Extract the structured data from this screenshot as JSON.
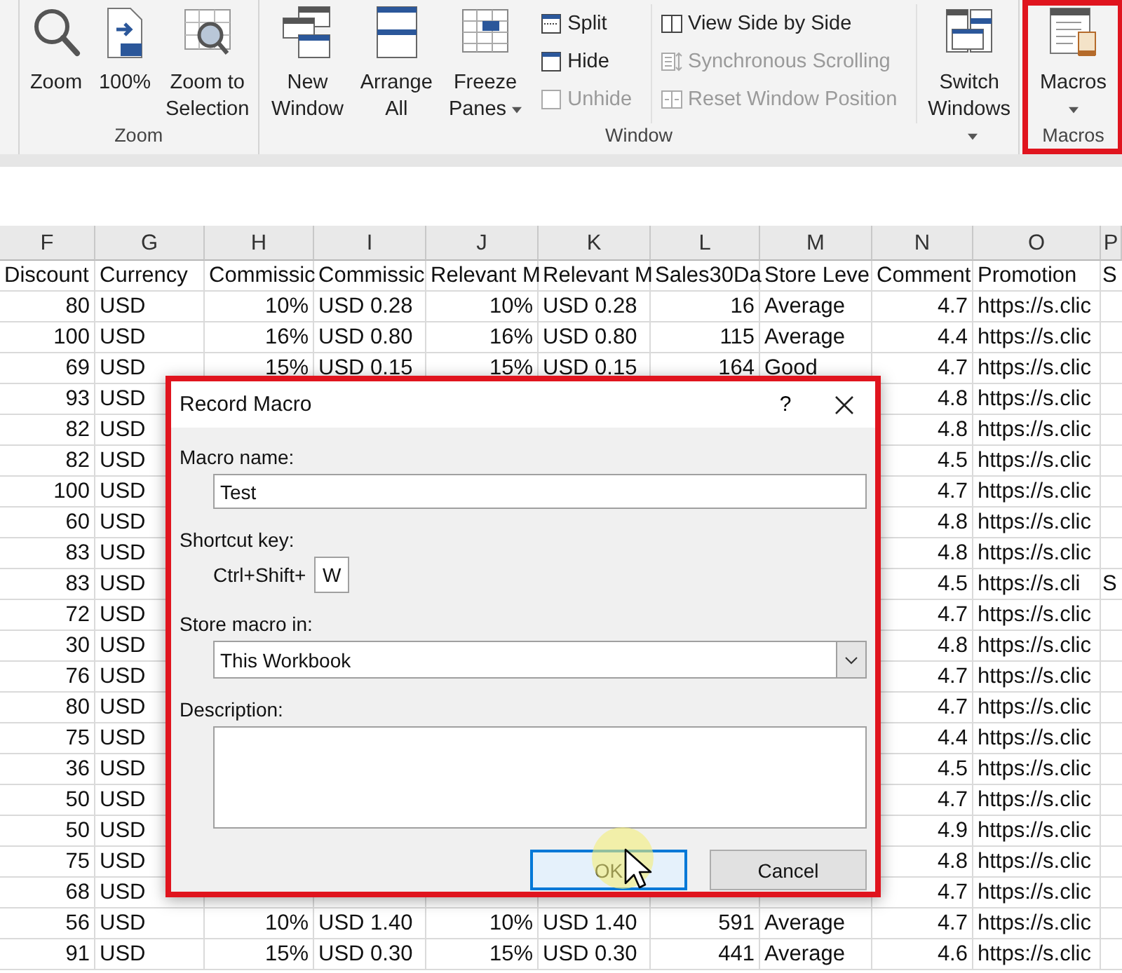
{
  "ribbon": {
    "groups": [
      {
        "label": "Zoom",
        "highlighted": false,
        "items": [
          {
            "kind": "large",
            "label": "Zoom",
            "dropdown": false
          },
          {
            "kind": "large",
            "label": "100%",
            "dropdown": false
          },
          {
            "kind": "large",
            "label": "Zoom to Selection",
            "dropdown": false
          }
        ]
      },
      {
        "label": "Window",
        "highlighted": false,
        "items": [
          {
            "kind": "large",
            "label": "New Window",
            "dropdown": false
          },
          {
            "kind": "large",
            "label": "Arrange All",
            "dropdown": false
          },
          {
            "kind": "large",
            "label": "Freeze Panes",
            "dropdown": true
          },
          {
            "kind": "stack",
            "items": [
              {
                "label": "Split",
                "disabled": false
              },
              {
                "label": "Hide",
                "disabled": false
              },
              {
                "label": "Unhide",
                "disabled": true
              }
            ]
          },
          {
            "kind": "stack",
            "items": [
              {
                "label": "View Side by Side",
                "disabled": false
              },
              {
                "label": "Synchronous Scrolling",
                "disabled": true
              },
              {
                "label": "Reset Window Position",
                "disabled": true
              }
            ]
          },
          {
            "kind": "large",
            "label": "Switch Windows",
            "dropdown": true
          }
        ]
      },
      {
        "label": "Macros",
        "highlighted": true,
        "items": [
          {
            "kind": "large",
            "label": "Macros",
            "dropdown": true
          }
        ]
      }
    ]
  },
  "sheet": {
    "columns": [
      {
        "letter": "F",
        "header": "Discount",
        "numeric": true
      },
      {
        "letter": "G",
        "header": "Currency",
        "numeric": false
      },
      {
        "letter": "H",
        "header": "Commissic",
        "numeric": true
      },
      {
        "letter": "I",
        "header": "Commissic",
        "numeric": false
      },
      {
        "letter": "J",
        "header": "Relevant M",
        "numeric": true
      },
      {
        "letter": "K",
        "header": "Relevant M",
        "numeric": false
      },
      {
        "letter": "L",
        "header": "Sales30Da",
        "numeric": true
      },
      {
        "letter": "M",
        "header": "Store Leve",
        "numeric": false
      },
      {
        "letter": "N",
        "header": "Comment",
        "numeric": true
      },
      {
        "letter": "O",
        "header": "Promotion",
        "numeric": false
      },
      {
        "letter": "P",
        "header": "S",
        "numeric": false
      }
    ],
    "rows": [
      {
        "F": "80",
        "G": "USD",
        "H": "10%",
        "I": "USD 0.28",
        "J": "10%",
        "K": "USD 0.28",
        "L": "16",
        "M": "Average",
        "N": "4.7",
        "O": "https://s.clic"
      },
      {
        "F": "100",
        "G": "USD",
        "H": "16%",
        "I": "USD 0.80",
        "J": "16%",
        "K": "USD 0.80",
        "L": "115",
        "M": "Average",
        "N": "4.4",
        "O": "https://s.clic"
      },
      {
        "F": "69",
        "G": "USD",
        "H": "15%",
        "I": "USD 0.15",
        "J": "15%",
        "K": "USD 0.15",
        "L": "164",
        "M": "Good",
        "N": "4.7",
        "O": "https://s.clic"
      },
      {
        "F": "93",
        "G": "USD",
        "N": "4.8",
        "O": "https://s.clic"
      },
      {
        "F": "82",
        "G": "USD",
        "N": "4.8",
        "O": "https://s.clic"
      },
      {
        "F": "82",
        "G": "USD",
        "N": "4.5",
        "O": "https://s.clic"
      },
      {
        "F": "100",
        "G": "USD",
        "N": "4.7",
        "O": "https://s.clic"
      },
      {
        "F": "60",
        "G": "USD",
        "N": "4.8",
        "O": "https://s.clic"
      },
      {
        "F": "83",
        "G": "USD",
        "N": "4.8",
        "O": "https://s.clic"
      },
      {
        "F": "83",
        "G": "USD",
        "N": "4.5",
        "O": "https://s.cli",
        "P": "S"
      },
      {
        "F": "72",
        "G": "USD",
        "N": "4.7",
        "O": "https://s.clic"
      },
      {
        "F": "30",
        "G": "USD",
        "N": "4.8",
        "O": "https://s.clic"
      },
      {
        "F": "76",
        "G": "USD",
        "N": "4.7",
        "O": "https://s.clic"
      },
      {
        "F": "80",
        "G": "USD",
        "N": "4.7",
        "O": "https://s.clic"
      },
      {
        "F": "75",
        "G": "USD",
        "N": "4.4",
        "O": "https://s.clic"
      },
      {
        "F": "36",
        "G": "USD",
        "N": "4.5",
        "O": "https://s.clic"
      },
      {
        "F": "50",
        "G": "USD",
        "N": "4.7",
        "O": "https://s.clic"
      },
      {
        "F": "50",
        "G": "USD",
        "N": "4.9",
        "O": "https://s.clic"
      },
      {
        "F": "75",
        "G": "USD",
        "N": "4.8",
        "O": "https://s.clic"
      },
      {
        "F": "68",
        "G": "USD",
        "N": "4.7",
        "O": "https://s.clic"
      },
      {
        "F": "56",
        "G": "USD",
        "H": "10%",
        "I": "USD 1.40",
        "J": "10%",
        "K": "USD 1.40",
        "L": "591",
        "M": "Average",
        "N": "4.7",
        "O": "https://s.clic"
      },
      {
        "F": "91",
        "G": "USD",
        "H": "15%",
        "I": "USD 0.30",
        "J": "15%",
        "K": "USD 0.30",
        "L": "441",
        "M": "Average",
        "N": "4.6",
        "O": "https://s.clic"
      }
    ]
  },
  "dialog": {
    "title": "Record Macro",
    "help": "?",
    "highlighted": true,
    "macro_name": {
      "label": "Macro name:",
      "value": "Test"
    },
    "shortcut": {
      "label": "Shortcut key:",
      "prefix": "Ctrl+Shift+",
      "value": "W"
    },
    "store_in": {
      "label": "Store macro in:",
      "value": "This Workbook"
    },
    "description": {
      "label": "Description:"
    },
    "buttons": [
      {
        "label": "OK",
        "default": true
      },
      {
        "label": "Cancel",
        "default": false
      }
    ]
  }
}
